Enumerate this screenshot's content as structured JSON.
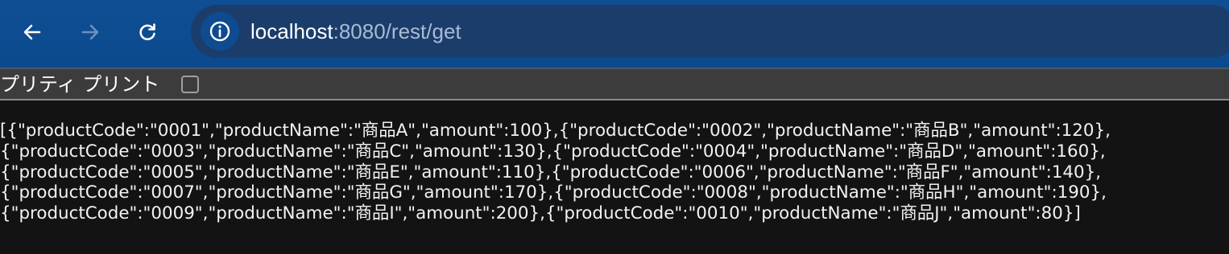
{
  "browser": {
    "url_host": "localhost",
    "url_rest": ":8080/rest/get",
    "back_icon": "arrow-left-icon",
    "forward_icon": "arrow-right-icon",
    "reload_icon": "reload-icon",
    "site_info_icon": "info-circle-icon"
  },
  "pretty_print": {
    "label": "プリティ プリント",
    "checked": false
  },
  "json_response": {
    "lines": [
      "[{\"productCode\":\"0001\",\"productName\":\"商品A\",\"amount\":100},{\"productCode\":\"0002\",\"productName\":\"商品B\",\"amount\":120},",
      "{\"productCode\":\"0003\",\"productName\":\"商品C\",\"amount\":130},{\"productCode\":\"0004\",\"productName\":\"商品D\",\"amount\":160},",
      "{\"productCode\":\"0005\",\"productName\":\"商品E\",\"amount\":110},{\"productCode\":\"0006\",\"productName\":\"商品F\",\"amount\":140},",
      "{\"productCode\":\"0007\",\"productName\":\"商品G\",\"amount\":170},{\"productCode\":\"0008\",\"productName\":\"商品H\",\"amount\":190},",
      "{\"productCode\":\"0009\",\"productName\":\"商品I\",\"amount\":200},{\"productCode\":\"0010\",\"productName\":\"商品J\",\"amount\":80}]"
    ]
  },
  "colors": {
    "toolbar_bg": "#0f4e93",
    "omnibox_bg": "#1b3d6b",
    "page_bg": "#131313",
    "text": "#f2f2f2"
  }
}
